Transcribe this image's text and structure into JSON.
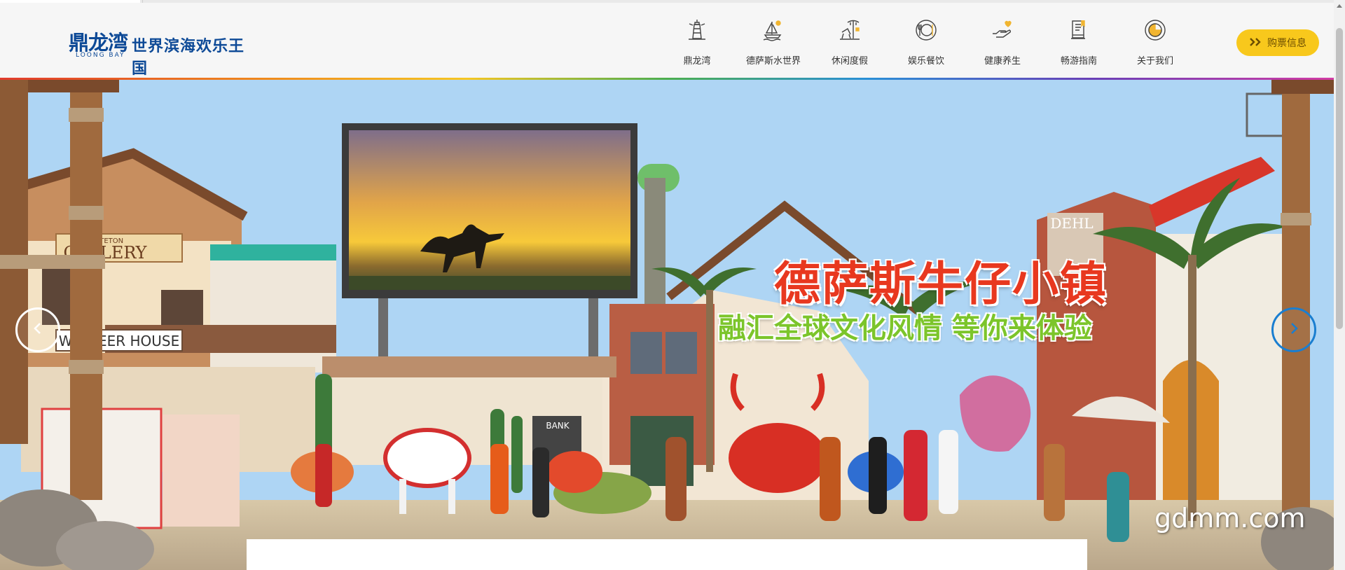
{
  "header": {
    "logo": {
      "brand_cn": "鼎龙湾",
      "brand_en": "LOONG BAY",
      "park_name": "世界滨海欢乐王国"
    },
    "nav": [
      {
        "label": "鼎龙湾",
        "icon": "lighthouse-icon"
      },
      {
        "label": "德萨斯水世界",
        "icon": "sailboat-icon"
      },
      {
        "label": "休闲度假",
        "icon": "beach-chair-icon"
      },
      {
        "label": "娱乐餐饮",
        "icon": "plate-icon"
      },
      {
        "label": "健康养生",
        "icon": "heart-hand-icon"
      },
      {
        "label": "畅游指南",
        "icon": "guidebook-icon"
      },
      {
        "label": "关于我们",
        "icon": "info-circle-icon"
      }
    ],
    "ticket_button": {
      "label": "购票信息",
      "icon": "double-chevron-icon"
    },
    "accent_gradient": [
      "#e23b2c",
      "#f08a1c",
      "#f6c622",
      "#4cae4f",
      "#2a8fd6",
      "#6b3fb6",
      "#d33ca5"
    ]
  },
  "banner": {
    "headline": "德萨斯牛仔小镇",
    "subheadline": "融汇全球文化风情 等你来体验",
    "watermark": "gdmm.com",
    "signs": {
      "gallery": "GALLERY",
      "gallery_small": "ND TETON",
      "cheer_house": "WH  HEER HOUSE",
      "bank": "BANK",
      "dehl": "DEHL"
    },
    "prev_icon": "chevron-left-icon",
    "next_icon": "chevron-right-icon"
  },
  "colors": {
    "brand_blue": "#0e4a97",
    "ticket_yellow": "#f8c81c",
    "headline_red": "#e8381f",
    "subhead_green": "#7cc52b"
  }
}
